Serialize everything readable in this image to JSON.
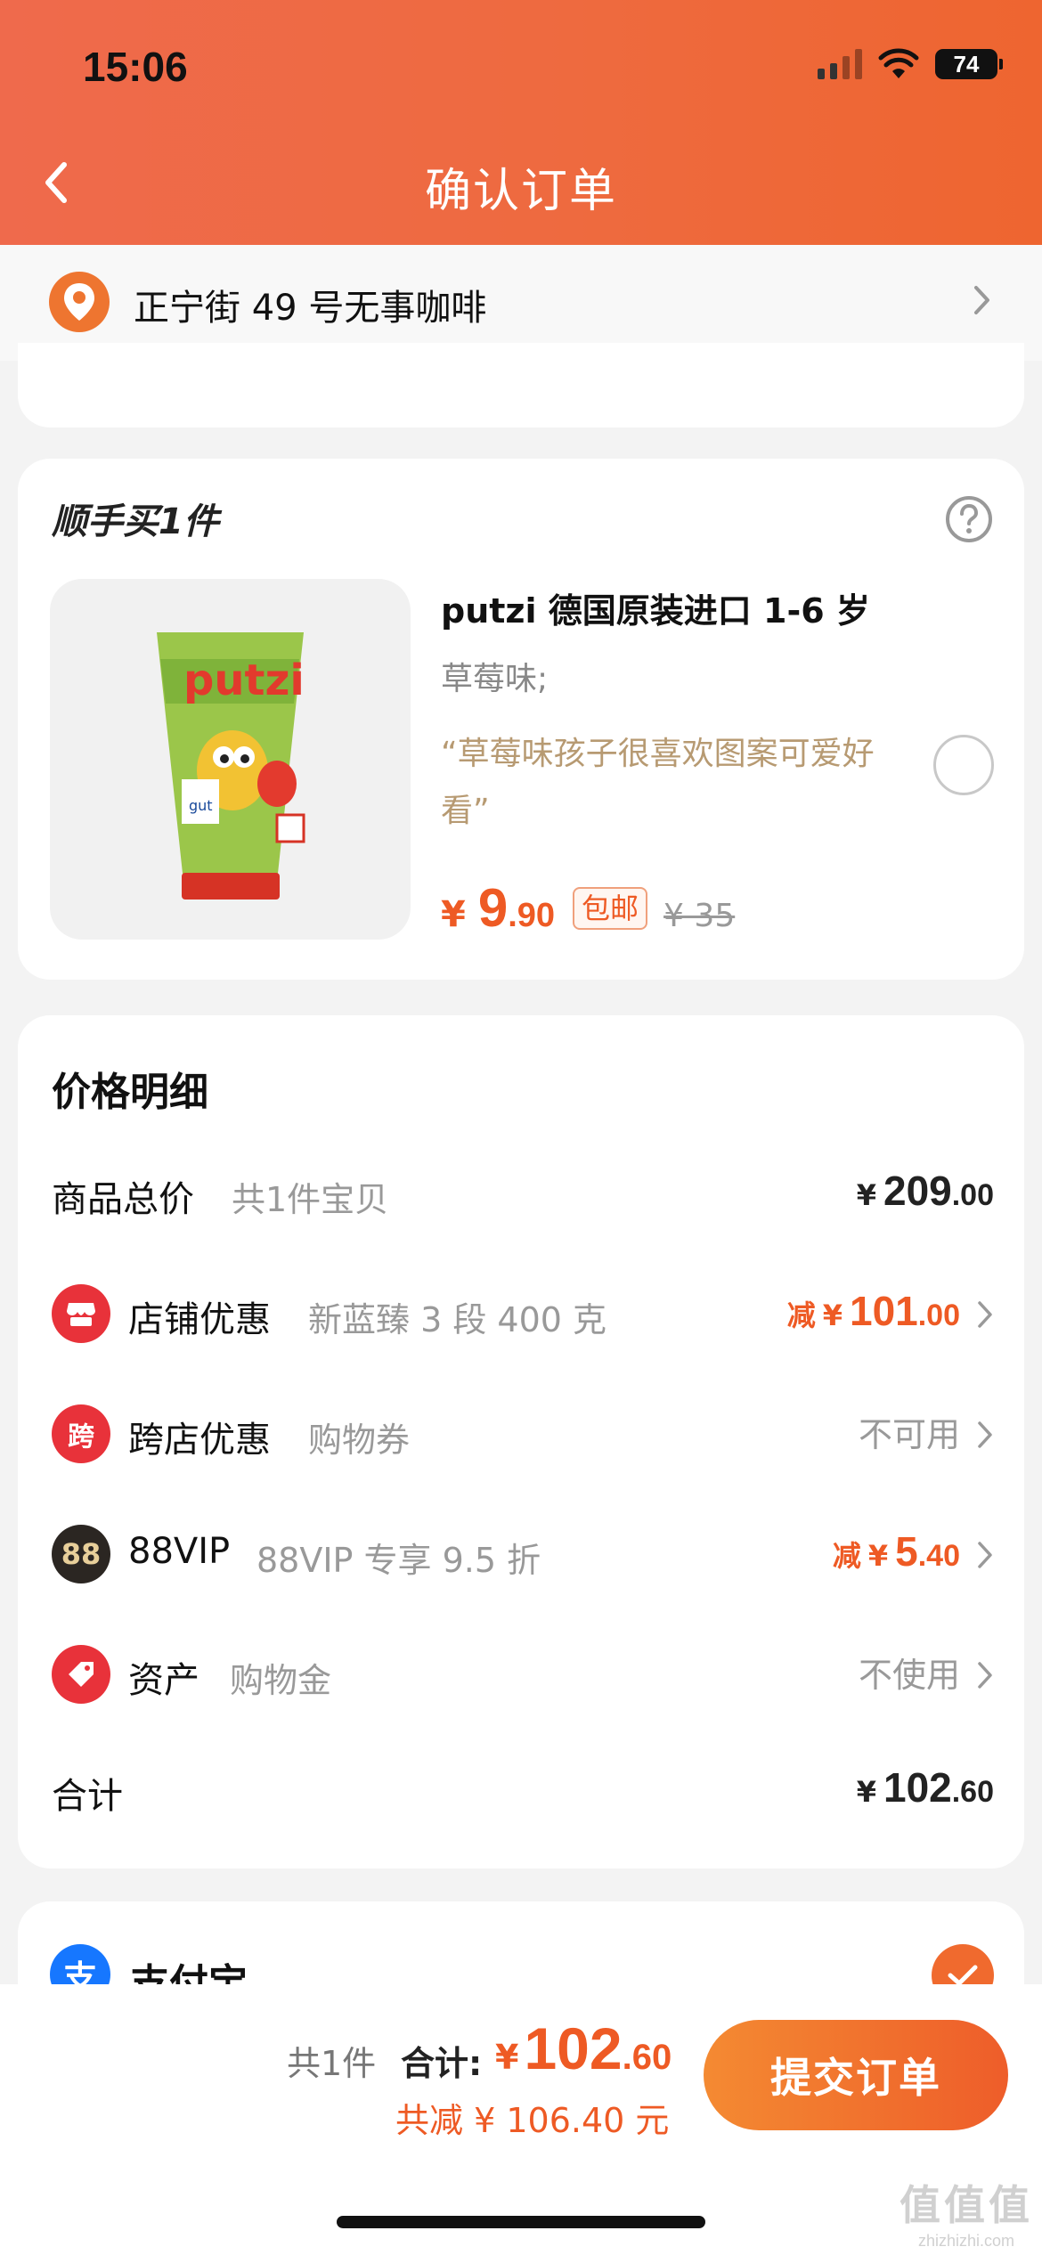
{
  "status_bar": {
    "time": "15:06",
    "battery": "74"
  },
  "header": {
    "title": "确认订单"
  },
  "address": {
    "text": "正宁街 49 号无事咖啡"
  },
  "addon": {
    "title": "顺手买1件",
    "product": {
      "name": "putzi 德国原装进口 1-6 岁",
      "spec": "草莓味;",
      "review": "“草莓味孩子很喜欢图案可爱好看”",
      "price_symbol": "¥",
      "price_int": "9",
      "price_dec": ".90",
      "shipping_badge": "包邮",
      "original_price": "¥ 35",
      "image_brand": "putzi",
      "image_label": "gut"
    }
  },
  "price_detail": {
    "heading": "价格明细",
    "rows": [
      {
        "label": "商品总价",
        "sub": "共1件宝贝",
        "prefix": "",
        "symbol": "¥",
        "int": "209",
        "dec": ".00"
      },
      {
        "label": "店铺优惠",
        "sub": "新蓝臻 3 段 400 克",
        "prefix": "减",
        "symbol": "¥",
        "int": "101",
        "dec": ".00"
      },
      {
        "label": "跨店优惠",
        "sub": "购物券",
        "status": "不可用",
        "icon_text": "跨"
      },
      {
        "label": "88VIP",
        "sub": "88VIP 专享 9.5 折",
        "prefix": "减",
        "symbol": "¥",
        "int": "5",
        "dec": ".40",
        "icon_text": "88"
      },
      {
        "label": "资产",
        "sub": "购物金",
        "status": "不使用"
      },
      {
        "label": "合计",
        "symbol": "¥",
        "int": "102",
        "dec": ".60"
      }
    ]
  },
  "payment": {
    "label": "支付宝",
    "icon_text": "支"
  },
  "bottom_bar": {
    "count": "共1件",
    "total_label": "合计:",
    "total_symbol": "¥",
    "total_int": "102",
    "total_dec": ".60",
    "saved": "共减 ¥ 106.40 元",
    "submit_label": "提交订单"
  },
  "watermark": {
    "logo": "值值值",
    "text": "zhizhizhi.com"
  },
  "colors": {
    "accent": "#ee5a24",
    "header": "#ee6a3f",
    "muted": "#999999",
    "review": "#b79a72"
  }
}
